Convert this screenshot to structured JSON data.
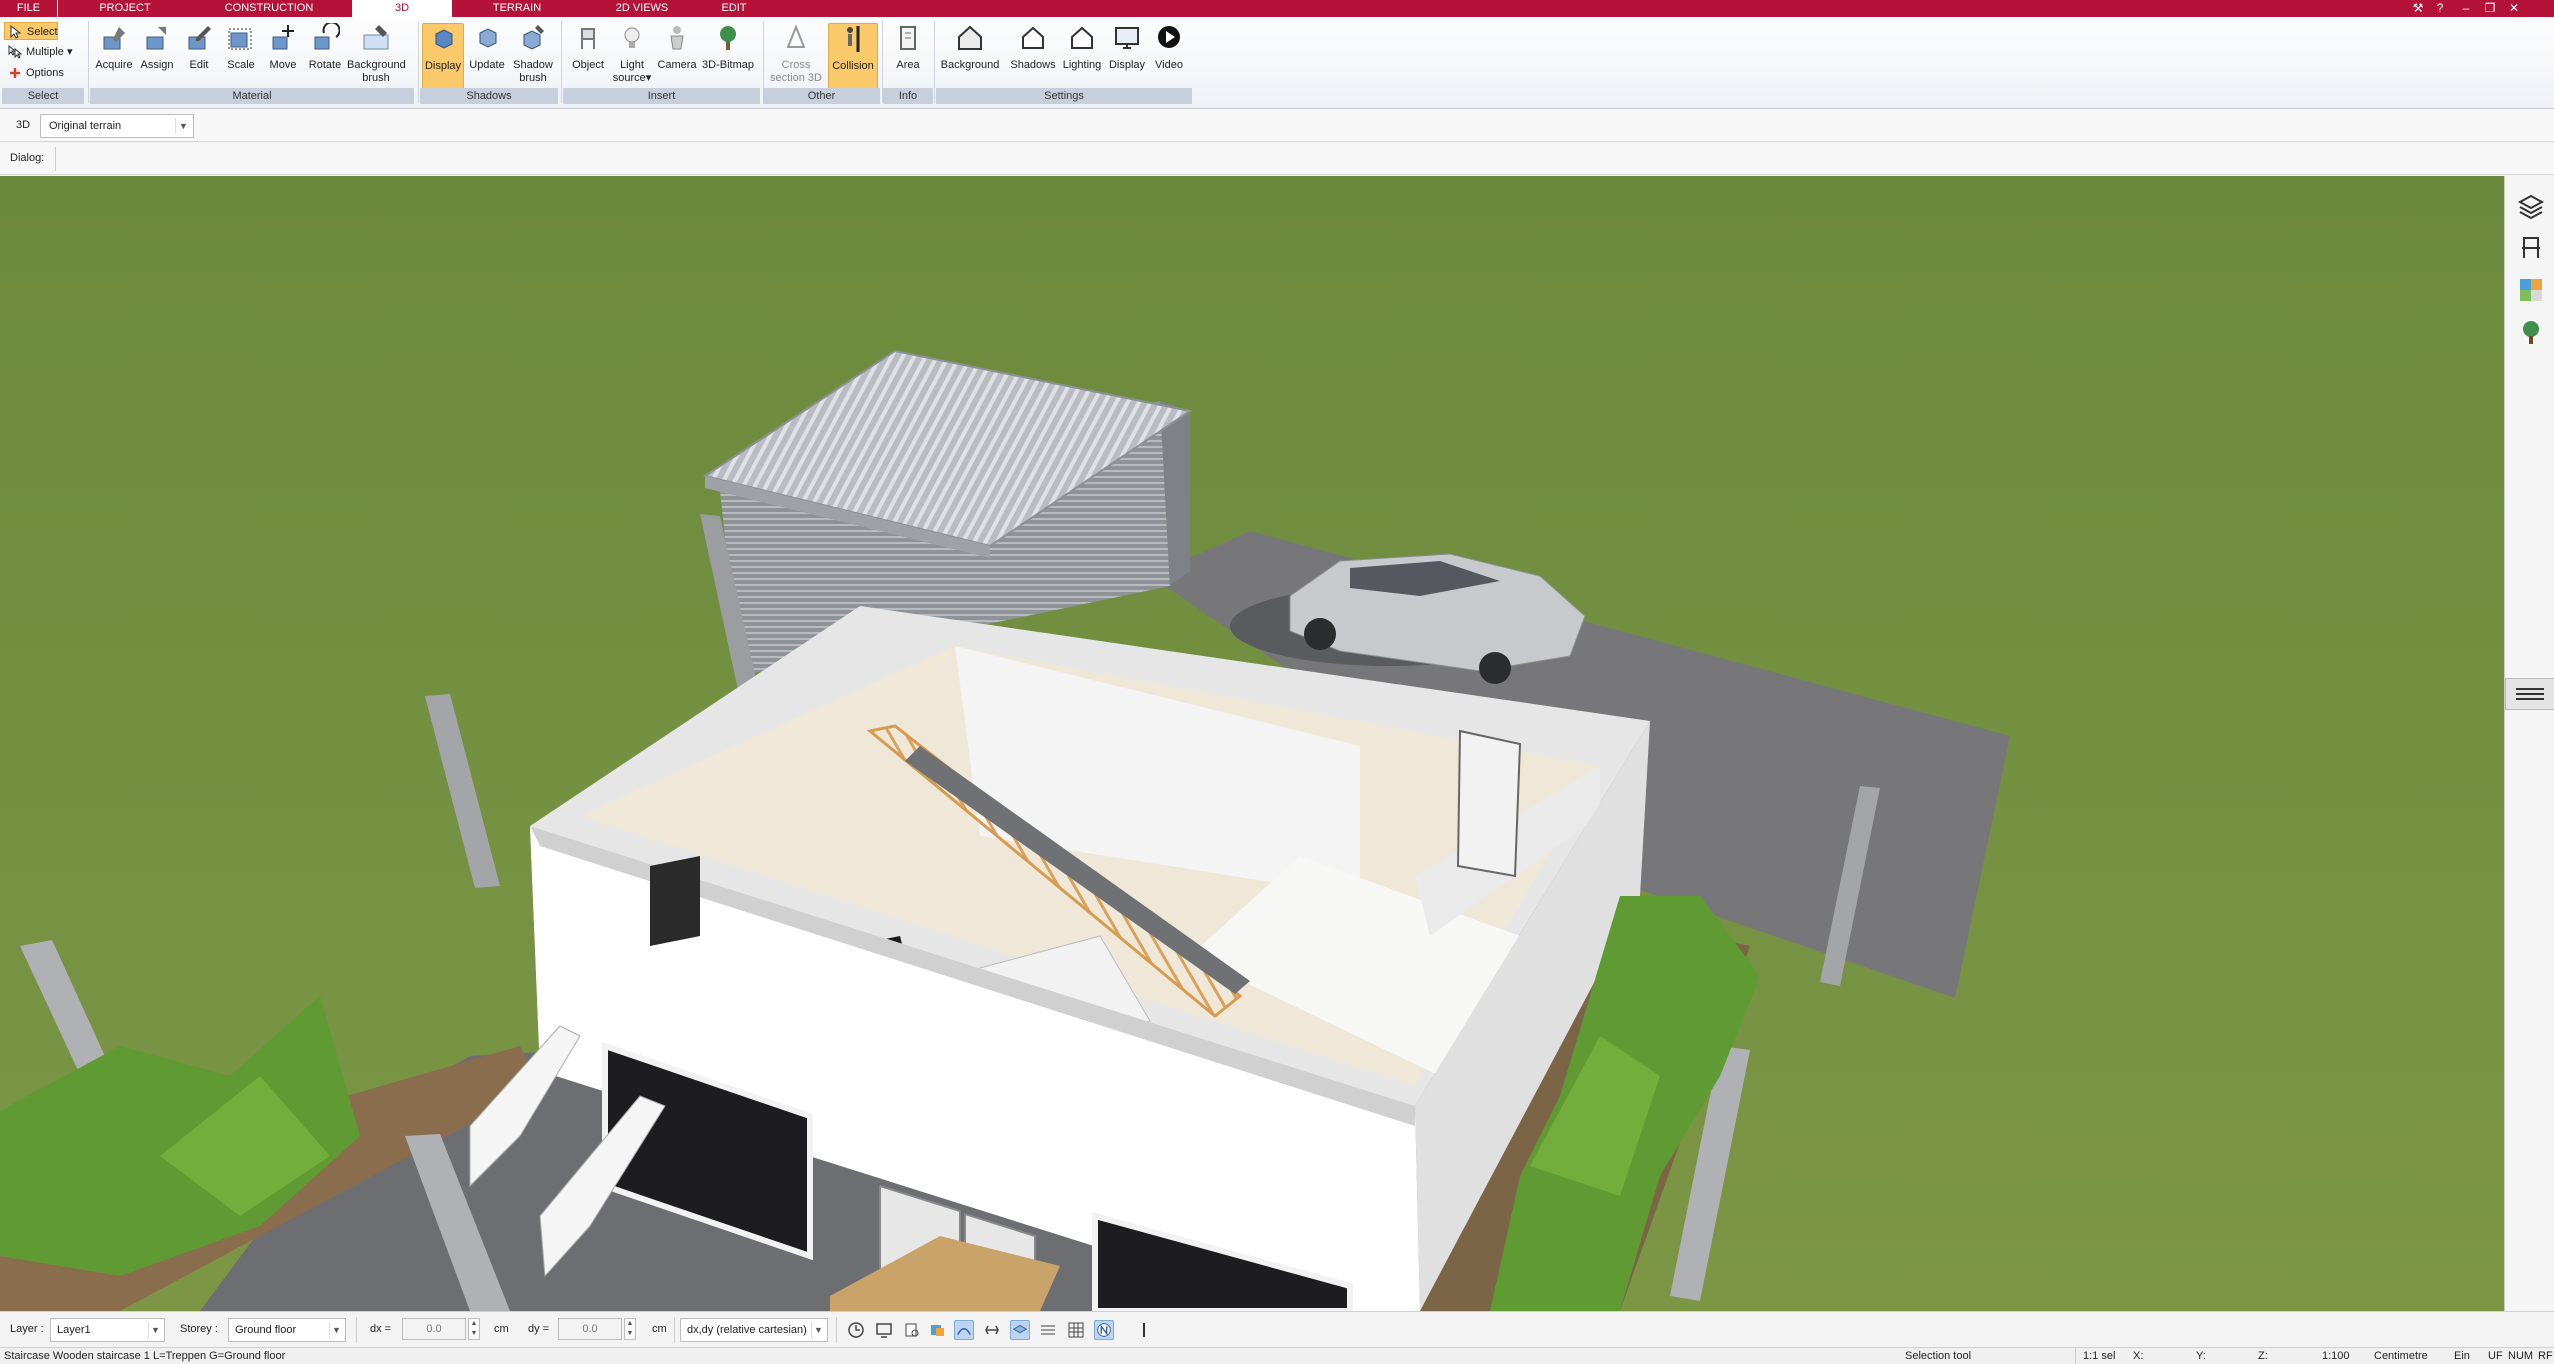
{
  "tabs": [
    {
      "label": "FILE"
    },
    {
      "label": "PROJECT"
    },
    {
      "label": "CONSTRUCTION"
    },
    {
      "label": "3D",
      "active": true
    },
    {
      "label": "TERRAIN"
    },
    {
      "label": "2D VIEWS"
    },
    {
      "label": "EDIT"
    }
  ],
  "ribbon": {
    "select_group": {
      "select": "Select",
      "multiple": "Multiple",
      "options": "Options",
      "group": "Select"
    },
    "material": {
      "acquire": "Acquire",
      "assign": "Assign",
      "edit": "Edit",
      "scale": "Scale",
      "move": "Move",
      "rotate": "Rotate",
      "bg_brush_1": "Background",
      "bg_brush_2": "brush",
      "group": "Material"
    },
    "shadows": {
      "display": "Display",
      "update": "Update",
      "shadow_brush_1": "Shadow",
      "shadow_brush_2": "brush",
      "group": "Shadows"
    },
    "insert": {
      "object": "Object",
      "light_1": "Light",
      "light_2": "source",
      "camera": "Camera",
      "bitmap": "3D-Bitmap",
      "group": "Insert"
    },
    "other": {
      "cross_1": "Cross",
      "cross_2": "section 3D",
      "collision": "Collision",
      "group": "Other"
    },
    "info": {
      "area": "Area",
      "group": "Info"
    },
    "settings": {
      "background": "Background",
      "shadows": "Shadows",
      "lighting": "Lighting",
      "display": "Display",
      "video": "Video",
      "group": "Settings"
    }
  },
  "optbar": {
    "mode": "3D",
    "terrain": "Original terrain"
  },
  "dialogbar": {
    "label": "Dialog:"
  },
  "bottombar": {
    "layer_label": "Layer :",
    "layer_value": "Layer1",
    "storey_label": "Storey :",
    "storey_value": "Ground floor",
    "dx_label": "dx =",
    "dx_value": "0.0",
    "dx_unit": "cm",
    "dy_label": "dy =",
    "dy_value": "0.0",
    "dy_unit": "cm",
    "coord_mode": "dx,dy (relative cartesian)"
  },
  "status": {
    "message": "Staircase Wooden staircase 1 L=Treppen G=Ground floor",
    "tool": "Selection tool",
    "selection": "1:1 sel",
    "x": "X:",
    "y": "Y:",
    "z": "Z:",
    "scale": "1:100",
    "unit": "Centimetre",
    "ein": "Ein",
    "uf": "UF",
    "num": "NUM",
    "rf": "RF"
  },
  "colors": {
    "tab_bar": "#b5123a",
    "active_highlight": "#f9c96a",
    "grass": "#6f8a3f",
    "paving": "#77777a",
    "walls": "#ffffff"
  },
  "icons": {
    "right_panel": [
      "layers-icon",
      "chair-icon",
      "materials-icon",
      "tree-icon"
    ]
  }
}
